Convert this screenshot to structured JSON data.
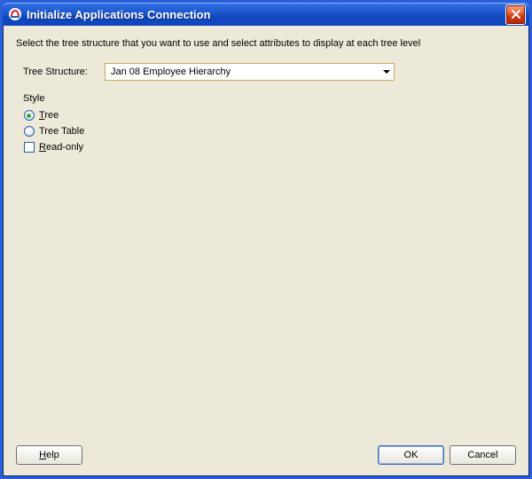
{
  "window": {
    "title": "Initialize Applications Connection"
  },
  "instruction": "Select the tree structure that you want to use and select attributes to display at each tree level",
  "form": {
    "tree_structure_label": "Tree Structure:",
    "tree_structure_value": "Jan 08 Employee Hierarchy"
  },
  "style_group": {
    "label": "Style",
    "options": {
      "tree": {
        "prefix": "T",
        "rest": "ree",
        "selected": true
      },
      "tree_table": {
        "prefix": "",
        "rest": "Tree Table",
        "selected": false
      },
      "read_only": {
        "prefix": "R",
        "rest": "ead-only",
        "checked": false
      }
    }
  },
  "buttons": {
    "help": {
      "prefix": "H",
      "rest": "elp"
    },
    "ok": "OK",
    "cancel": "Cancel"
  }
}
